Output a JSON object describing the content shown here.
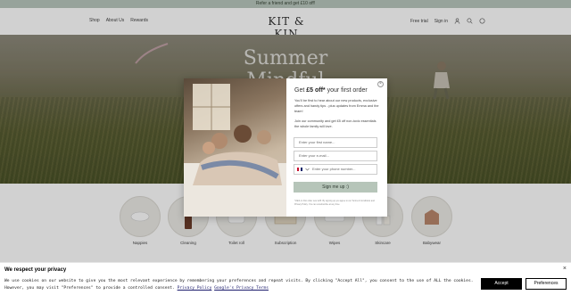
{
  "announcement": "Refer a friend and get £10 off!",
  "header": {
    "logo": "KIT & KIN",
    "nav_left": [
      "Shop",
      "About Us",
      "Rewards"
    ],
    "nav_right": {
      "free_trial": "Free trial",
      "sign_in": "Sign in"
    },
    "icons": [
      "user-icon",
      "search-icon",
      "bag-icon"
    ]
  },
  "hero": {
    "title_line1": "Summer",
    "title_line2": "Mindful"
  },
  "categories": [
    "Nappies",
    "Cleaning",
    "Toilet roll",
    "Subscription",
    "Wipes",
    "Skincare",
    "Babywear"
  ],
  "modal": {
    "title_prefix": "Get ",
    "title_offer": "£5 off*",
    "title_suffix": " your first order",
    "intro": "You'll be first to hear about our new products, exclusive offers and handy tips - plus updates from Emma and the team!",
    "join": "Join our community and get £5 off non-toxic essentials the whole family will love.",
    "first_name_placeholder": "Enter your first name...",
    "email_placeholder": "Enter your e-mail...",
    "phone_placeholder": "Enter your phone number...",
    "signup_label": "Sign me up :)",
    "fine_print": "*Valid on first order over £25. By signing up you agree to our Terms & Conditions and Privacy Policy. You can unsubscribe at any time.",
    "close": "×"
  },
  "cookie": {
    "title": "We respect your privacy",
    "text_before": "We use cookies on our website to give you the most relevant experience by remembering your preferences and repeat visits. By clicking \"Accept All\", you consent to the use of ALL the cookies. However, you may visit \"Preferences\" to provide a controlled consent. ",
    "privacy_link": "Privacy Policy",
    "google_link": "Google's Privacy Terms",
    "accept": "Accept",
    "preferences": "Preferences",
    "close": "×"
  }
}
